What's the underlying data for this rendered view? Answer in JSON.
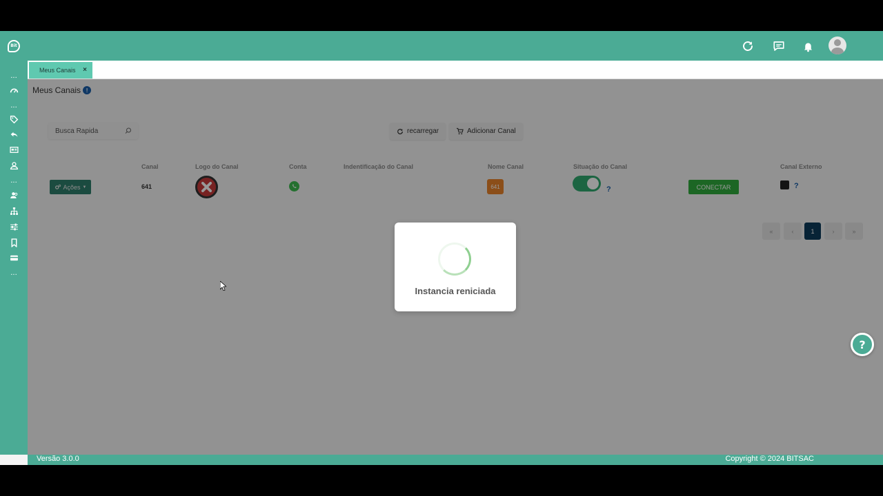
{
  "topbar": {
    "logo_text": "Bit",
    "icons": [
      "refresh-icon",
      "chat-icon",
      "bell-icon",
      "avatar"
    ]
  },
  "sidebar": {
    "items": [
      {
        "icon": "more-icon",
        "label": "..."
      },
      {
        "icon": "dashboard-icon"
      },
      {
        "icon": "more-icon",
        "label": "..."
      },
      {
        "icon": "tag-icon"
      },
      {
        "icon": "reply-icon"
      },
      {
        "icon": "card-icon"
      },
      {
        "icon": "user-icon"
      },
      {
        "icon": "more-icon",
        "label": "..."
      },
      {
        "icon": "users-icon"
      },
      {
        "icon": "org-chart-icon"
      },
      {
        "icon": "sliders-icon"
      },
      {
        "icon": "bookmark-icon"
      },
      {
        "icon": "credit-card-icon"
      },
      {
        "icon": "more-icon",
        "label": "..."
      }
    ]
  },
  "tabs": [
    {
      "label": "Meus Canais",
      "close": "×"
    }
  ],
  "page": {
    "title": "Meus Canais",
    "info": "!"
  },
  "toolbar": {
    "search_placeholder": "Busca Rapida",
    "reload_label": "recarregar",
    "add_label": "Adicionar Canal"
  },
  "table": {
    "headers": [
      "Canal",
      "Logo do Canal",
      "Conta",
      "Indentificação do Canal",
      "Nome Canal",
      "Situação do Canal",
      "Canal Externo"
    ],
    "row": {
      "actions_label": "Ações",
      "canal": "641",
      "nome_badge": "641",
      "situacao_help": "?",
      "connect_label": "CONECTAR",
      "externo_help": "?"
    }
  },
  "pagination": {
    "first": "«",
    "prev": "‹",
    "current": "1",
    "next": "›",
    "last": "»"
  },
  "footer": {
    "version": "Versão 3.0.0",
    "copyright": "Copyright © 2024 BITSAC"
  },
  "modal": {
    "message": "Instancia reniciada"
  },
  "help_button": "?",
  "colors": {
    "brand": "#4bab95",
    "tab_active": "#5fc9b0",
    "connect": "#2faa3c",
    "badge": "#e8832a",
    "pager_active": "#0d3b5a"
  }
}
